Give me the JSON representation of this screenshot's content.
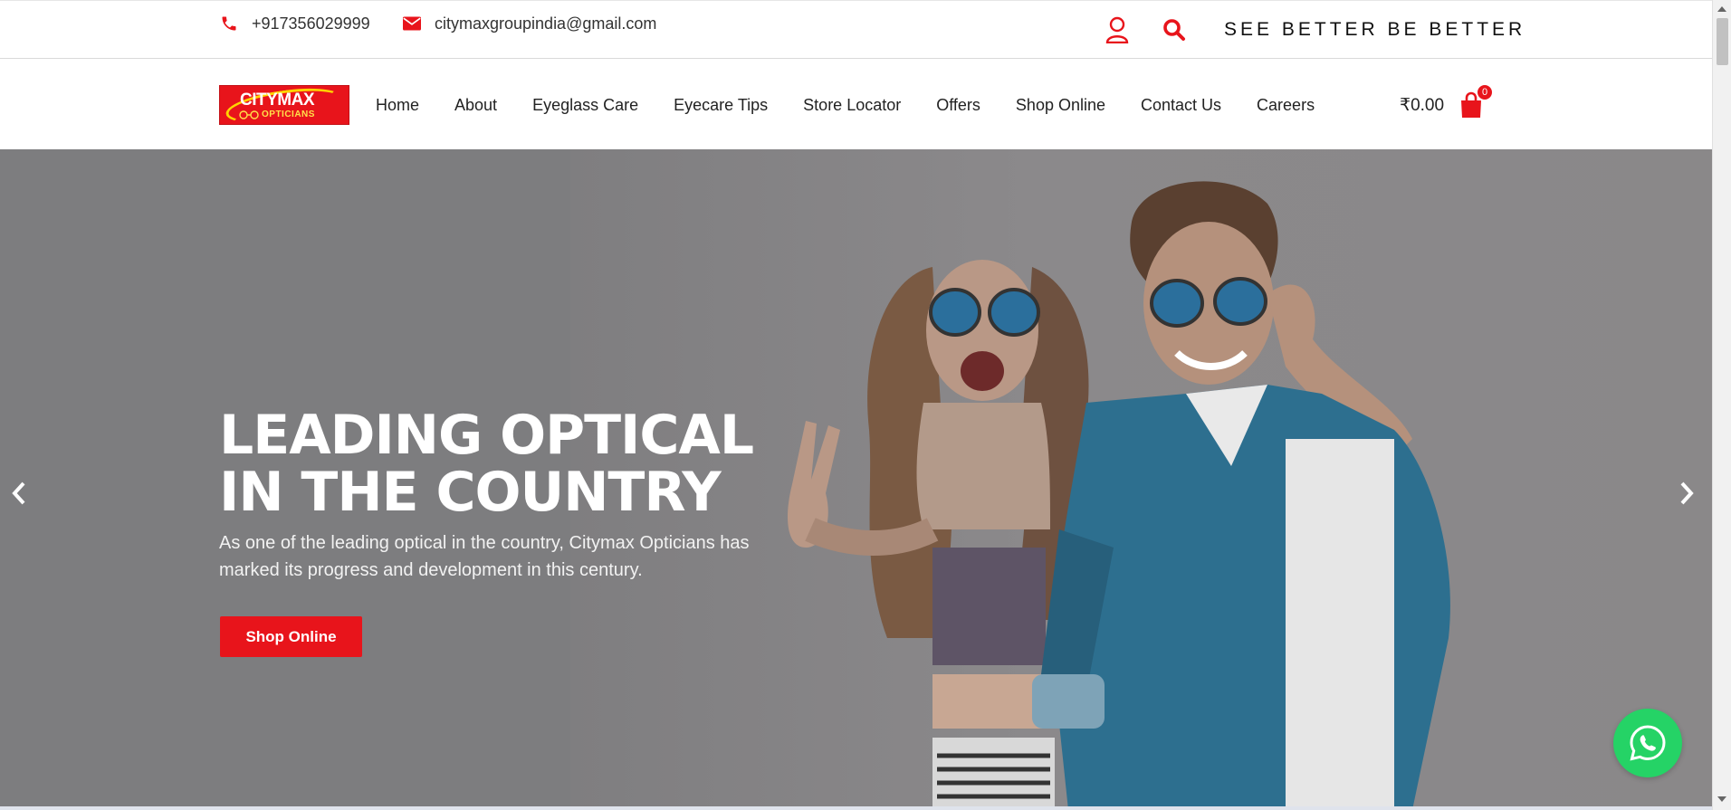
{
  "colors": {
    "accent": "#e8141b",
    "hero_overlay": "#7d7d7f",
    "whatsapp": "#25d366",
    "logo_yellow": "#ffd400"
  },
  "topbar": {
    "phone": "+917356029999",
    "email": "citymaxgroupindia@gmail.com",
    "tagline": "SEE BETTER BE BETTER",
    "icons": [
      "phone-icon",
      "envelope-icon",
      "user-icon",
      "search-icon"
    ]
  },
  "logo": {
    "line1": "CITYMAX",
    "line2": "OPTICIANS"
  },
  "nav": {
    "items": [
      {
        "label": "Home"
      },
      {
        "label": "About"
      },
      {
        "label": "Eyeglass Care"
      },
      {
        "label": "Eyecare Tips"
      },
      {
        "label": "Store Locator"
      },
      {
        "label": "Offers"
      },
      {
        "label": "Shop Online"
      },
      {
        "label": "Contact Us"
      },
      {
        "label": "Careers"
      }
    ],
    "cart_total": "₹0.00",
    "cart_count": "0"
  },
  "hero": {
    "title": "LEADING OPTICAL IN THE COUNTRY",
    "subtitle": "As one of the leading optical in the country, Citymax Opticians has marked its progress and development in this century.",
    "button_label": "Shop Online",
    "icons": [
      "chevron-left-icon",
      "chevron-right-icon",
      "whatsapp-icon"
    ]
  }
}
